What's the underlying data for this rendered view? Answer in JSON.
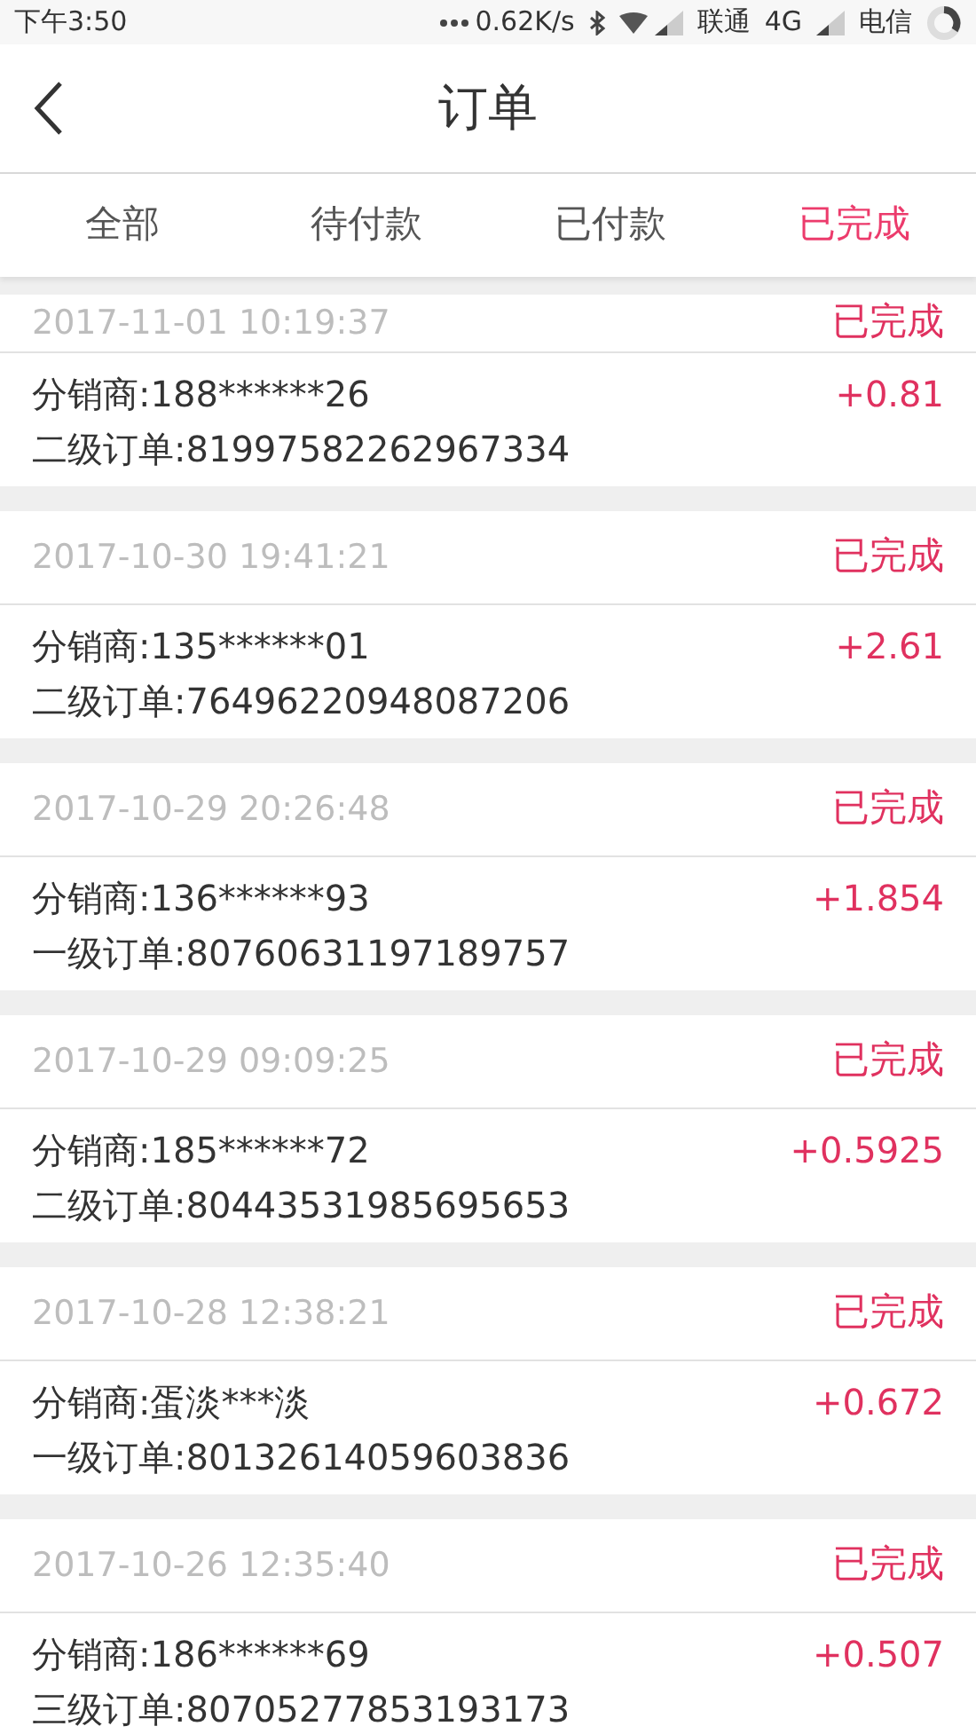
{
  "status_bar": {
    "time": "下午3:50",
    "speed": "0.62K/s",
    "carrier_1": "联通",
    "network": "4G",
    "carrier_2": "电信"
  },
  "nav": {
    "title": "订单"
  },
  "tabs": [
    {
      "label": "全部",
      "selected": false
    },
    {
      "label": "待付款",
      "selected": false
    },
    {
      "label": "已付款",
      "selected": false
    },
    {
      "label": "已完成",
      "selected": true
    }
  ],
  "orders": [
    {
      "time": "2017-11-01 10:19:37",
      "status": "已完成",
      "distributor": "分销商:188******26",
      "order": "二级订单:81997582262967334",
      "amount": "+0.81"
    },
    {
      "time": "2017-10-30 19:41:21",
      "status": "已完成",
      "distributor": "分销商:135******01",
      "order": "二级订单:76496220948087206",
      "amount": "+2.61"
    },
    {
      "time": "2017-10-29 20:26:48",
      "status": "已完成",
      "distributor": "分销商:136******93",
      "order": "一级订单:80760631197189757",
      "amount": "+1.854"
    },
    {
      "time": "2017-10-29 09:09:25",
      "status": "已完成",
      "distributor": "分销商:185******72",
      "order": "二级订单:80443531985695653",
      "amount": "+0.5925"
    },
    {
      "time": "2017-10-28 12:38:21",
      "status": "已完成",
      "distributor": "分销商:蛋淡***淡",
      "order": "一级订单:80132614059603836",
      "amount": "+0.672"
    },
    {
      "time": "2017-10-26 12:35:40",
      "status": "已完成",
      "distributor": "分销商:186******69",
      "order": "三级订单:80705277853193173",
      "amount": "+0.507"
    }
  ]
}
